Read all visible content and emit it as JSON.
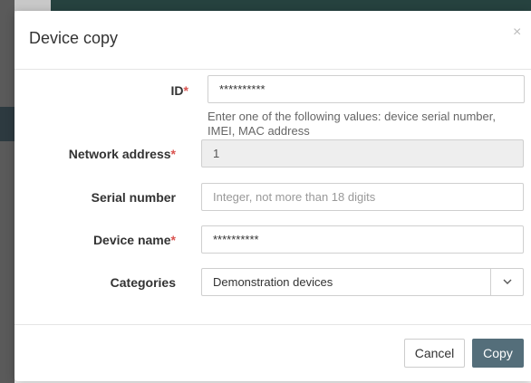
{
  "dialog": {
    "title": "Device copy",
    "close_icon": "×"
  },
  "form": {
    "required_marker": "*",
    "id": {
      "label": "ID",
      "value": "**********",
      "help": "Enter one of the following values: device serial number, IMEI, MAC address"
    },
    "network_address": {
      "label": "Network address",
      "value": "1"
    },
    "serial_number": {
      "label": "Serial number",
      "placeholder": "Integer, not more than 18 digits"
    },
    "device_name": {
      "label": "Device name",
      "value": "**********"
    },
    "categories": {
      "label": "Categories",
      "selected": "Demonstration devices",
      "chevron_icon": "chevron-down-icon"
    }
  },
  "footer": {
    "cancel_label": "Cancel",
    "copy_label": "Copy"
  },
  "colors": {
    "primary_button": "#546e7a",
    "required": "#d9534f",
    "disabled_input": "#eeeeee"
  }
}
